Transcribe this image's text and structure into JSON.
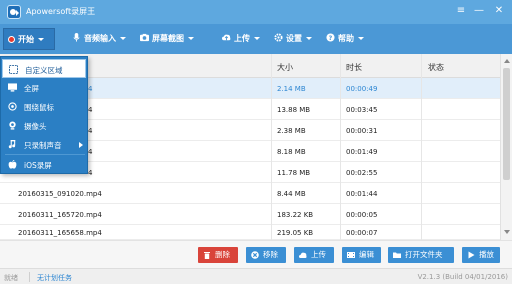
{
  "window": {
    "title": "Apowersoft录屏王",
    "menu_glyph": "≡",
    "minimize_glyph": "—",
    "close_glyph": "✕"
  },
  "toolbar": {
    "start": "开始",
    "audio_input": "音频输入",
    "screenshot": "屏幕截图",
    "upload": "上传",
    "settings": "设置",
    "help": "帮助"
  },
  "start_menu": {
    "items": [
      {
        "label": "自定义区域",
        "icon": "region-select-icon"
      },
      {
        "label": "全屏",
        "icon": "monitor-icon"
      },
      {
        "label": "围绕鼠标",
        "icon": "cursor-region-icon"
      },
      {
        "label": "摄像头",
        "icon": "webcam-icon"
      },
      {
        "label": "只录制声音",
        "icon": "music-note-icon"
      },
      {
        "label": "iOS录屏",
        "icon": "apple-icon"
      }
    ]
  },
  "table": {
    "columns": [
      "大小",
      "时长",
      "状态"
    ],
    "rows": [
      {
        "name": "4",
        "size": "2.14 MB",
        "duration": "00:00:49",
        "status": ""
      },
      {
        "name": "4",
        "size": "13.88 MB",
        "duration": "00:03:45",
        "status": ""
      },
      {
        "name": "4",
        "size": "2.38 MB",
        "duration": "00:00:31",
        "status": ""
      },
      {
        "name": "4",
        "size": "8.18 MB",
        "duration": "00:01:49",
        "status": ""
      },
      {
        "name": "4",
        "size": "11.78 MB",
        "duration": "00:02:55",
        "status": ""
      },
      {
        "name": "20160315_091020.mp4",
        "size": "8.44 MB",
        "duration": "00:01:44",
        "status": ""
      },
      {
        "name": "20160311_165720.mp4",
        "size": "183.22 KB",
        "duration": "00:00:05",
        "status": ""
      },
      {
        "name": "20160311_165658.mp4",
        "size": "219.05 KB",
        "duration": "00:00:07",
        "status": ""
      }
    ]
  },
  "actions": {
    "delete": "删除",
    "remove": "移除",
    "upload": "上传",
    "edit": "编辑",
    "open_folder": "打开文件夹",
    "play": "播放"
  },
  "status": {
    "left": "就绪",
    "task_link": "无计划任务",
    "version": "V2.1.3 (Build 04/01/2016)"
  },
  "colors": {
    "titlebar": "#5ea8df",
    "toolbar": "#4b98d6",
    "menu": "#2b7fc4",
    "delete_button": "#d9443a",
    "action_button": "#3b8fd4",
    "selected_text": "#2d86d2"
  }
}
